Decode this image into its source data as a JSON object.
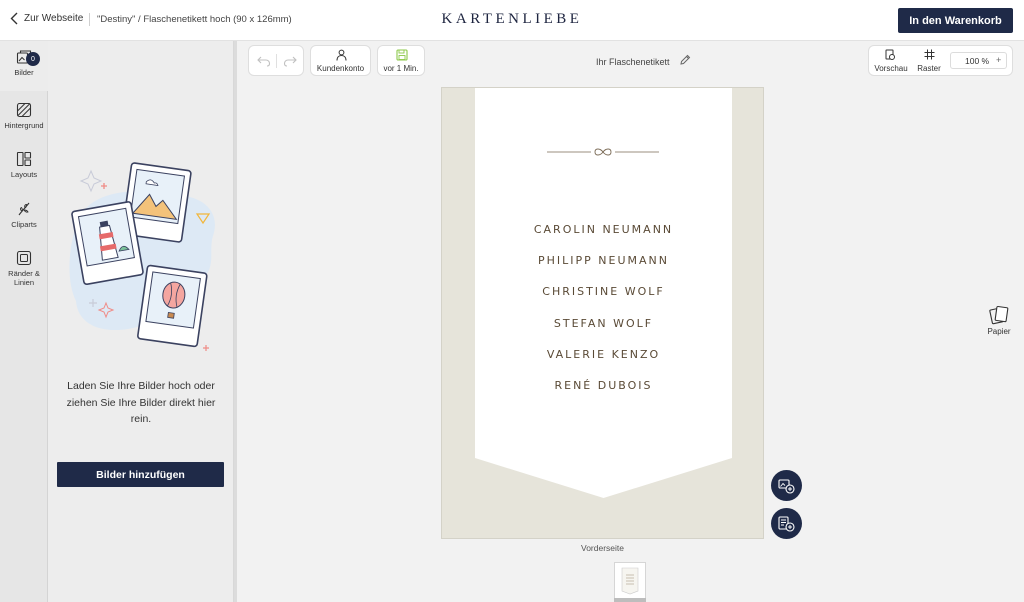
{
  "header": {
    "back_label": "Zur Webseite",
    "breadcrumb": "\"Destiny\" / Flaschenetikett hoch (90 x 126mm)",
    "brand": "KARTENLIEBE",
    "cart_button": "In den Warenkorb"
  },
  "sidebar": {
    "badge_count": "0",
    "items": [
      {
        "label": "Bilder",
        "icon": "images-icon"
      },
      {
        "label": "Hintergrund",
        "icon": "background-icon"
      },
      {
        "label": "Layouts",
        "icon": "layouts-icon"
      },
      {
        "label": "Cliparts",
        "icon": "cliparts-icon"
      },
      {
        "label": "Ränder &",
        "label2": "Linien",
        "icon": "borders-icon"
      }
    ]
  },
  "panel": {
    "hint_line1": "Laden Sie Ihre Bilder hoch oder",
    "hint_line2": "ziehen Sie Ihre Bilder direkt hier",
    "hint_line3": "rein.",
    "add_button": "Bilder hinzufügen"
  },
  "toolbar": {
    "account_label": "Kundenkonto",
    "saved_label": "vor 1 Min.",
    "project_title": "Ihr Flaschenetikett",
    "preview_label": "Vorschau",
    "grid_label": "Raster",
    "zoom_value": "100 %",
    "zoom_plus": "+"
  },
  "canvas": {
    "names": [
      "CAROLIN NEUMANN",
      "PHILIPP NEUMANN",
      "CHRISTINE WOLF",
      "STEFAN WOLF",
      "VALERIE KENZO",
      "RENÉ DUBOIS"
    ],
    "side_label": "Vorderseite"
  },
  "right_panel": {
    "paper_label": "Papier"
  },
  "colors": {
    "navy": "#1f2a48",
    "canvas_bg": "#e6e4da",
    "name_text": "#5a4a36"
  }
}
